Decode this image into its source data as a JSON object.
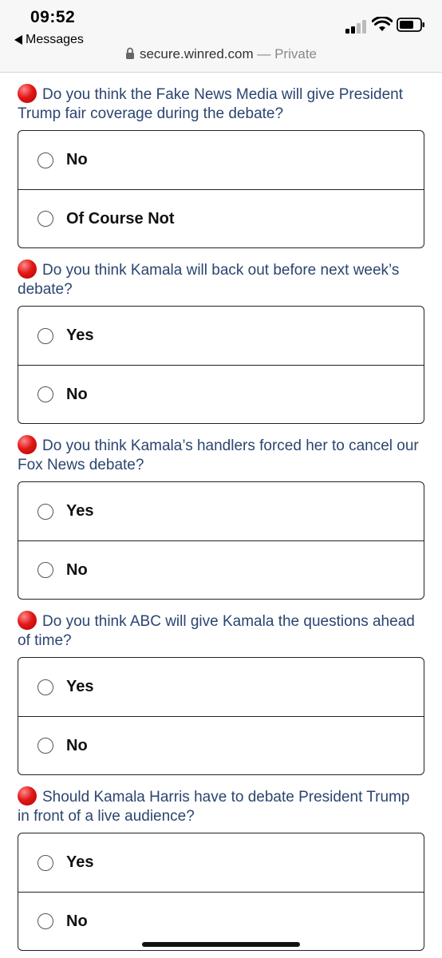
{
  "status_bar": {
    "time": "09:52",
    "back_label": "Messages"
  },
  "url_bar": {
    "domain": "secure.winred.com",
    "separator": " — ",
    "mode": "Private"
  },
  "questions": [
    {
      "text": "Do you think the Fake News Media will give President Trump fair coverage during the debate?",
      "options": [
        "No",
        "Of Course Not"
      ]
    },
    {
      "text": "Do you think Kamala will back out before next week’s debate?",
      "options": [
        "Yes",
        "No"
      ]
    },
    {
      "text": "Do you think Kamala’s handlers forced her to cancel our Fox News debate?",
      "options": [
        "Yes",
        "No"
      ]
    },
    {
      "text": "Do you think ABC will give Kamala the questions ahead of time?",
      "options": [
        "Yes",
        "No"
      ]
    },
    {
      "text": "Should Kamala Harris have to debate President Trump in front of a live audience?",
      "options": [
        "Yes",
        "No"
      ]
    }
  ],
  "colors": {
    "question_text": "#2b4570",
    "red_dot": "#e11818"
  }
}
